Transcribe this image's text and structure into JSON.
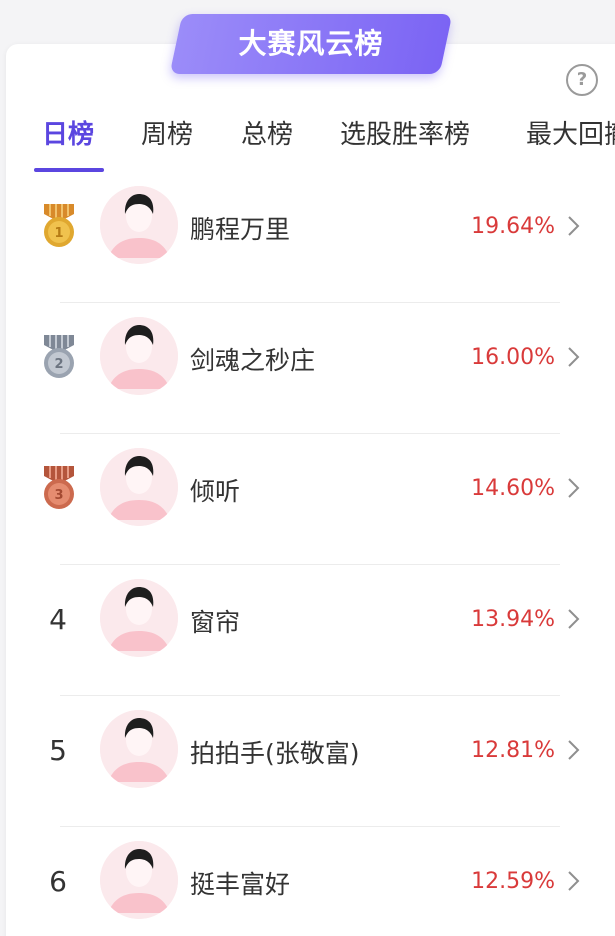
{
  "header": {
    "title": "大赛风云榜",
    "help_icon": "question-circle-icon",
    "help_glyph": "?"
  },
  "tabs": [
    {
      "label": "日榜",
      "active": true
    },
    {
      "label": "周榜",
      "active": false
    },
    {
      "label": "总榜",
      "active": false
    },
    {
      "label": "选股胜率榜",
      "active": false
    },
    {
      "label": "最大回撤榜",
      "active": false
    }
  ],
  "ranking": [
    {
      "rank": "1",
      "badge": "gold-medal-icon",
      "name": "鹏程万里",
      "return": "19.64%"
    },
    {
      "rank": "2",
      "badge": "silver-medal-icon",
      "name": "剑魂之秒庄",
      "return": "16.00%"
    },
    {
      "rank": "3",
      "badge": "bronze-medal-icon",
      "name": "倾听",
      "return": "14.60%"
    },
    {
      "rank": "4",
      "badge": "",
      "name": "窗帘",
      "return": "13.94%"
    },
    {
      "rank": "5",
      "badge": "",
      "name": "拍拍手(张敬富)",
      "return": "12.81%"
    },
    {
      "rank": "6",
      "badge": "",
      "name": "挺丰富好",
      "return": "12.59%"
    }
  ],
  "colors": {
    "accent": "#5b46e0",
    "banner_start": "#9b8cf9",
    "banner_end": "#7b64f4",
    "return_red": "#d93a3a",
    "gold": "#e0a830",
    "silver": "#9aa3b0",
    "bronze": "#cc6a4e"
  }
}
